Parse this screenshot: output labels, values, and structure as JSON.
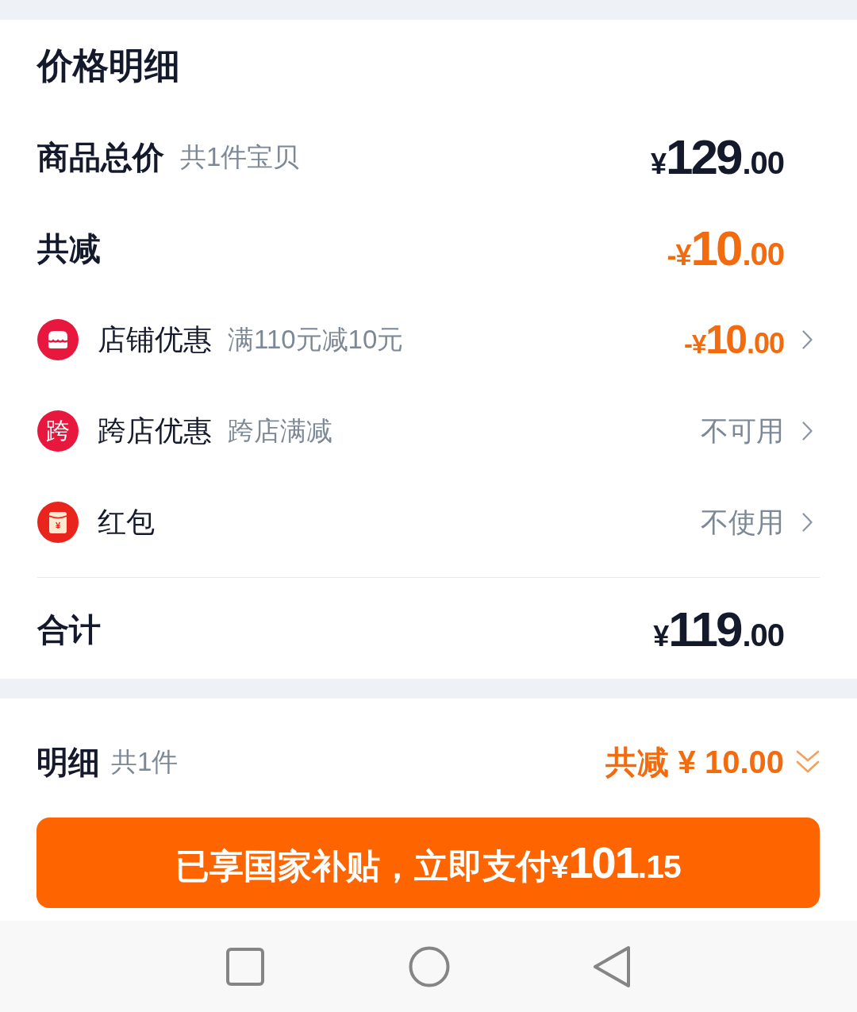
{
  "title": "价格明细",
  "summary": [
    {
      "label": "商品总价",
      "note": "共1件宝贝",
      "amount": {
        "kind": "price",
        "sign": "¥",
        "whole": "129",
        "cents": ".00"
      }
    },
    {
      "label": "共减",
      "amount": {
        "kind": "reduction",
        "sign": "-¥",
        "whole": "10",
        "cents": ".00"
      }
    }
  ],
  "discounts": [
    {
      "kind": "shop",
      "label": "店铺优惠",
      "note": "满110元减10元",
      "amount": {
        "kind": "reduction",
        "sign": "-¥",
        "whole": "10",
        "cents": ".00"
      }
    },
    {
      "kind": "badge",
      "badge_text": "跨",
      "label": "跨店优惠",
      "note": "跨店满减",
      "value": "不可用"
    },
    {
      "kind": "envelope",
      "badge_text": "¥",
      "label": "红包",
      "value": "不使用"
    }
  ],
  "total": {
    "label": "合计",
    "amount": {
      "kind": "price",
      "sign": "¥",
      "whole": "119",
      "cents": ".00"
    }
  },
  "detail_bar": {
    "label": "明细",
    "note": "共1件",
    "saving": "共减 ¥ 10.00"
  },
  "pay_button": {
    "label": "已享国家补贴，立即支付",
    "amount": {
      "sign": "¥",
      "whole": "101",
      "cents": ".15"
    }
  }
}
